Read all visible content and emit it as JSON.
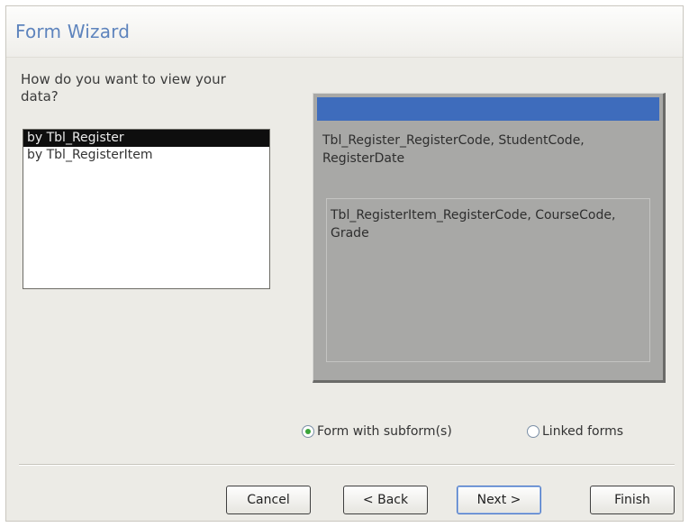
{
  "window": {
    "title": "Form Wizard"
  },
  "question": "How do you want to view your data?",
  "view_list": {
    "items": [
      {
        "label": "by Tbl_Register",
        "selected": true
      },
      {
        "label": "by Tbl_RegisterItem",
        "selected": false
      }
    ]
  },
  "preview": {
    "main_fields": "Tbl_Register_RegisterCode, StudentCode, RegisterDate",
    "subform_fields": "Tbl_RegisterItem_RegisterCode, CourseCode, Grade"
  },
  "options": {
    "form_with_subforms": {
      "label": "Form with subform(s)",
      "checked": true
    },
    "linked_forms": {
      "label": "Linked forms",
      "checked": false
    }
  },
  "buttons": {
    "cancel": "Cancel",
    "back": "< Back",
    "next": "Next >",
    "finish": "Finish"
  },
  "colors": {
    "title_text": "#5e84bd",
    "preview_bar": "#3e6cbc",
    "preview_bg": "#a8a8a6",
    "selection_bg": "#0e0e0e"
  }
}
